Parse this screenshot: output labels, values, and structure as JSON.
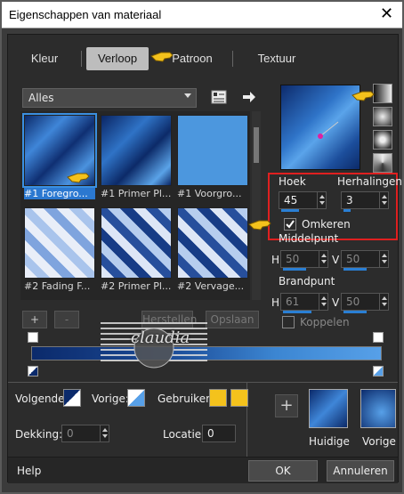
{
  "window": {
    "title": "Eigenschappen van materiaal",
    "close": "✕"
  },
  "tabs": [
    {
      "label": "Kleur"
    },
    {
      "label": "Verloop"
    },
    {
      "label": "Patroon"
    },
    {
      "label": "Textuur"
    }
  ],
  "library": {
    "dropdown_value": "Alles",
    "tiles": [
      {
        "caption": "#1 Foregro..."
      },
      {
        "caption": "#1 Primer Pl..."
      },
      {
        "caption": "#1 Voorgro..."
      },
      {
        "caption": "#2 Fading F..."
      },
      {
        "caption": "#2 Primer Pl..."
      },
      {
        "caption": "#2 Vervage..."
      }
    ],
    "add_label": "+",
    "remove_label": "-",
    "reset_label": "Herstellen",
    "save_label": "Opslaan"
  },
  "settings": {
    "hoek_label": "Hoek",
    "hoek_value": "45",
    "herhalingen_label": "Herhalingen",
    "herhalingen_value": "3",
    "omkeren_label": "Omkeren",
    "omkeren_checked": true,
    "middelpunt_label": "Middelpunt",
    "h_label": "H",
    "v_label": "V",
    "middel_h": "50",
    "middel_v": "50",
    "brandpunt_label": "Brandpunt",
    "brand_h": "61",
    "brand_v": "50",
    "koppelen_label": "Koppelen"
  },
  "editor": {
    "volgende_label": "Volgende:",
    "vorige_label": "Vorige:",
    "gebruiker_label": "Gebruiker:",
    "gebruiker_color1": "#f4c21c",
    "gebruiker_color2": "#f4c21c",
    "dekking_label": "Dekking:",
    "dekking_value": "0",
    "locatie_label": "Locatie:",
    "locatie_value": "0",
    "add_button": "+",
    "huidige_label": "Huidige",
    "vorige_swatch_label": "Vorige"
  },
  "watermark": {
    "text": "claudia"
  },
  "footer": {
    "help": "Help",
    "ok": "OK",
    "cancel": "Annuleren"
  },
  "colors": {
    "accent": "#2b78d0",
    "highlight_box": "#e02020",
    "pointer": "#f4c21c"
  }
}
